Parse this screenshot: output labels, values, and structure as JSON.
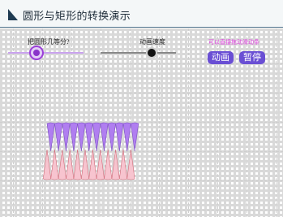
{
  "app": {
    "title": "圆形与矩形的转换演示"
  },
  "controls": {
    "slider_divide": {
      "label": "把圆形几等分?",
      "value_fraction": 0.38,
      "accent": "#9b3fd8"
    },
    "slider_speed": {
      "label": "动画速度",
      "value_fraction": 0.68
    },
    "hint": "可以直接拖动滑动条",
    "animate_label": "动画",
    "pause_label": "暂停"
  },
  "shape": {
    "sector_count": 12,
    "upper_color": "#b07ef0",
    "lower_color": "#f7c4cf",
    "lower_stroke": "#d36c7a"
  },
  "colors": {
    "button": "#6a4fd4",
    "hint": "#e040e0",
    "title_rule": "#4c6f88"
  }
}
